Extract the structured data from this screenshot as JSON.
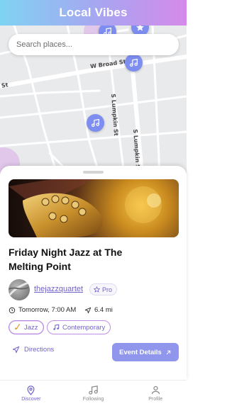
{
  "app": {
    "title": "Local Vibes"
  },
  "search": {
    "placeholder": "Search places...",
    "value": ""
  },
  "map": {
    "road_labels": [
      "W Broad St",
      "St",
      "S Lumpkin St",
      "S Lumpkin St"
    ],
    "pins": [
      {
        "icon": "music-note-icon"
      },
      {
        "icon": "star-icon"
      },
      {
        "icon": "music-note-icon"
      },
      {
        "icon": "music-note-icon"
      }
    ]
  },
  "event": {
    "title": "Friday Night Jazz at The Melting Point",
    "host": {
      "username": "thejazzquartet",
      "badge": "Pro"
    },
    "datetime": "Tomorrow, 7:00 AM",
    "distance": "6.4 mi",
    "tags": [
      {
        "label": "Jazz",
        "icon": "saxophone-icon"
      },
      {
        "label": "Contemporary",
        "icon": "music-note-icon"
      }
    ],
    "directions_label": "Directions",
    "details_label": "Event Details"
  },
  "nav": {
    "items": [
      {
        "label": "Discover",
        "icon": "map-pin-icon",
        "active": true
      },
      {
        "label": "Following",
        "icon": "music-note-icon",
        "active": false
      },
      {
        "label": "Profile",
        "icon": "user-icon",
        "active": false
      }
    ]
  },
  "colors": {
    "accent": "#6f63c9",
    "pin": "#7d8ef0",
    "button": "#8f96ec"
  }
}
